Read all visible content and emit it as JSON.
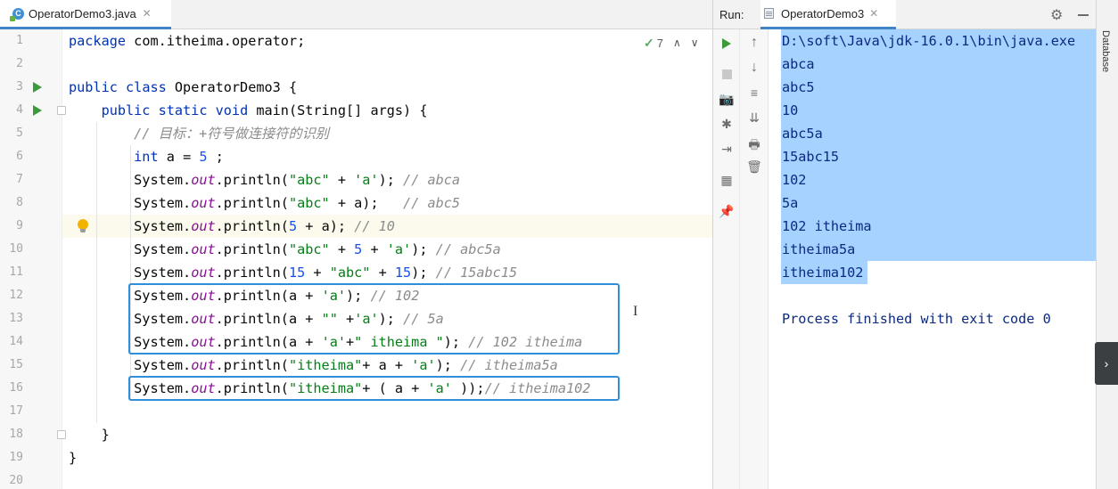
{
  "editor": {
    "tab": {
      "file_name": "OperatorDemo3.java",
      "icon": "java-class-icon",
      "close": "✕"
    },
    "inspection": {
      "check": "✓",
      "count": "7",
      "up": "∧",
      "down": "∨"
    },
    "lines": [
      {
        "n": "1",
        "text": "package com.itheima.operator;"
      },
      {
        "n": "2",
        "text": ""
      },
      {
        "n": "3",
        "text": "public class OperatorDemo3 {"
      },
      {
        "n": "4",
        "text": "    public static void main(String[] args) {"
      },
      {
        "n": "5",
        "text": "        // 目标：+符号做连接符的识别"
      },
      {
        "n": "6",
        "text": "        int a = 5 ;"
      },
      {
        "n": "7",
        "text": "        System.out.println(\"abc\" + 'a'); // abca"
      },
      {
        "n": "8",
        "text": "        System.out.println(\"abc\" + a);   // abc5"
      },
      {
        "n": "9",
        "text": "        System.out.println(5 + a); // 10"
      },
      {
        "n": "10",
        "text": "        System.out.println(\"abc\" + 5 + 'a'); // abc5a"
      },
      {
        "n": "11",
        "text": "        System.out.println(15 + \"abc\" + 15); // 15abc15"
      },
      {
        "n": "12",
        "text": "        System.out.println(a + 'a'); // 102"
      },
      {
        "n": "13",
        "text": "        System.out.println(a + \"\" +'a'); // 5a"
      },
      {
        "n": "14",
        "text": "        System.out.println(a + 'a'+\" itheima \"); // 102 itheima"
      },
      {
        "n": "15",
        "text": "        System.out.println(\"itheima\"+ a + 'a'); // itheima5a"
      },
      {
        "n": "16",
        "text": "        System.out.println(\"itheima\"+ ( a + 'a' ));// itheima102"
      },
      {
        "n": "17",
        "text": ""
      },
      {
        "n": "18",
        "text": "    }"
      },
      {
        "n": "19",
        "text": "}"
      },
      {
        "n": "20",
        "text": ""
      }
    ],
    "current_line": "9",
    "run_gutter_lines": [
      "3",
      "4"
    ],
    "highlight_boxes": [
      {
        "name": "highlight-box-lines-12-14",
        "lines": [
          "12",
          "14"
        ]
      },
      {
        "name": "highlight-box-line-16",
        "lines": [
          "16",
          "16"
        ]
      }
    ]
  },
  "run_panel": {
    "label": "Run:",
    "tab": {
      "name": "OperatorDemo3",
      "icon": "console-icon",
      "close": "✕"
    },
    "header_icons": [
      "gear-icon",
      "minimize-icon"
    ],
    "left_tools": [
      "rerun-icon",
      "stop-icon",
      "camera-icon",
      "debug-icon",
      "exit-icon",
      "layout-icon",
      "pin-icon"
    ],
    "right_tools": [
      "scroll-up-icon",
      "scroll-down-icon",
      "soft-wrap-icon",
      "scroll-to-end-icon",
      "print-icon",
      "trash-icon"
    ],
    "output": [
      "D:\\soft\\Java\\jdk-16.0.1\\bin\\java.exe",
      "abca",
      "abc5",
      "10",
      "abc5a",
      "15abc15",
      "102",
      "5a",
      "102 itheima",
      "itheima5a",
      "itheima102",
      "",
      "Process finished with exit code 0"
    ],
    "selected_lines": 11
  },
  "right_sidebar": {
    "database_label": "Database",
    "expand": "›"
  },
  "colors": {
    "keyword": "#0033b3",
    "string": "#067d17",
    "number": "#1750eb",
    "static_field": "#871094",
    "comment": "#8c8c8c",
    "console_text": "#0b2a80",
    "selection": "#a6d2ff",
    "box_border": "#2f8fd8"
  }
}
